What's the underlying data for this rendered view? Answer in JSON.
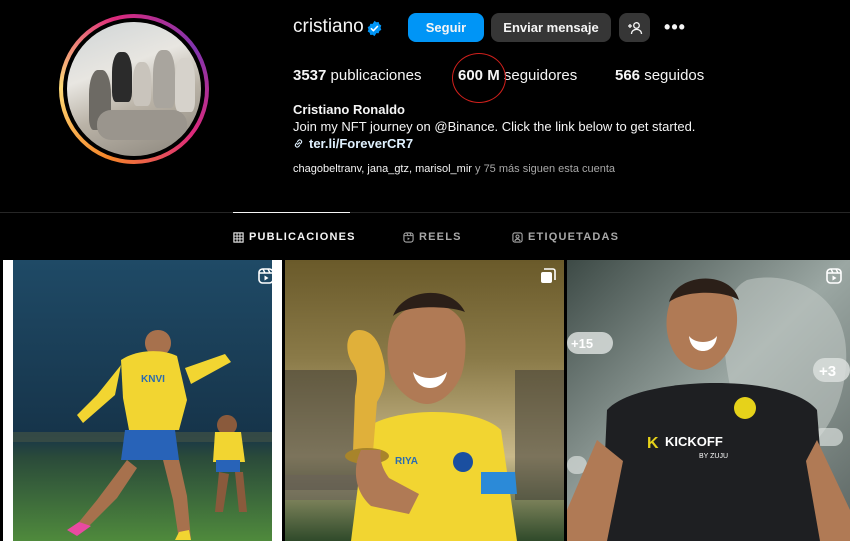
{
  "profile": {
    "username": "cristiano",
    "full_name": "Cristiano Ronaldo",
    "bio": "Join my NFT journey on @Binance. Click the link below to get started.",
    "link": "ter.li/ForeverCR7"
  },
  "actions": {
    "follow_label": "Seguir",
    "message_label": "Enviar mensaje",
    "more_label": "•••"
  },
  "stats": {
    "posts_count": "3537",
    "posts_label": "publicaciones",
    "followers_count": "600 M",
    "followers_label": "seguidores",
    "following_count": "566",
    "following_label": "seguidos"
  },
  "followed_by": {
    "names": "chagobeltranv, jana_gtz, marisol_mir",
    "rest": " y 75 más siguen esta cuenta"
  },
  "tabs": [
    {
      "label": "PUBLICACIONES",
      "icon": "grid-icon",
      "active": true
    },
    {
      "label": "REELS",
      "icon": "reels-icon",
      "active": false
    },
    {
      "label": "ETIQUETADAS",
      "icon": "tagged-icon",
      "active": false
    }
  ],
  "posts": [
    {
      "type": "reel",
      "icon": "reel-icon",
      "jersey_text": "KNVI"
    },
    {
      "type": "carousel",
      "icon": "carousel-icon",
      "jersey_text": "RIYA"
    },
    {
      "type": "reel",
      "icon": "reel-icon",
      "shirt_text": "KICKOFF",
      "shirt_subtext": "BY ZUJU",
      "badges": [
        "+15",
        "+3",
        "15"
      ]
    }
  ],
  "colors": {
    "accent_blue": "#0095f6",
    "button_gray": "#363636",
    "annotation_red": "#d0201c",
    "jersey_yellow": "#f2d531",
    "kit_dark": "#1e1f22"
  }
}
